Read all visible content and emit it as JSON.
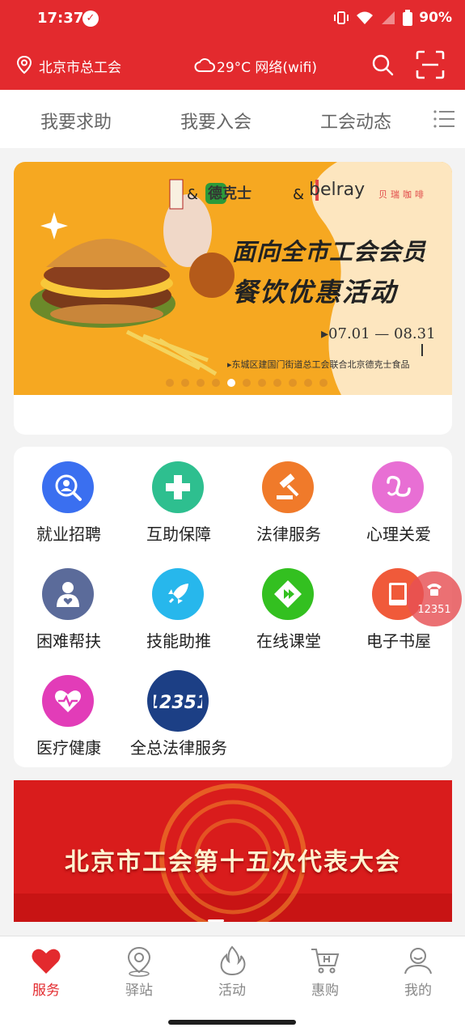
{
  "status": {
    "time": "17:37",
    "battery": "90%"
  },
  "header": {
    "location": "北京市总工会",
    "weather": "29°C  网络(wifi)"
  },
  "tabs": [
    {
      "label": "我要求助"
    },
    {
      "label": "我要入会"
    },
    {
      "label": "工会动态"
    }
  ],
  "banner": {
    "brand_de": "德克士",
    "brand_belray": "belray",
    "brand_coffee": "贝瑞咖啡",
    "amp": "&",
    "title_line1": "面向全市工会会员",
    "title_line2": "餐饮优惠活动",
    "date_range": "▸07.01 — 08.31",
    "subtitle": "▸东城区建国门街道总工会联合北京德克士食品",
    "dots_total": 11,
    "active_dot": 4
  },
  "services": [
    {
      "label": "就业招聘",
      "icon": "job-search-icon",
      "color": "#3a6ff0"
    },
    {
      "label": "互助保障",
      "icon": "medical-cross-icon",
      "color": "#2ebf8f"
    },
    {
      "label": "法律服务",
      "icon": "gavel-icon",
      "color": "#f07a2a"
    },
    {
      "label": "心理关爱",
      "icon": "heart-swirl-icon",
      "color": "#e86fd4"
    },
    {
      "label": "困难帮扶",
      "icon": "person-heart-icon",
      "color": "#5b6b9a"
    },
    {
      "label": "技能助推",
      "icon": "rocket-icon",
      "color": "#27b7ec"
    },
    {
      "label": "在线课堂",
      "icon": "play-video-icon",
      "color": "#33c020"
    },
    {
      "label": "电子书屋",
      "icon": "book-icon",
      "color": "#f05a3a"
    },
    {
      "label": "医疗健康",
      "icon": "heartbeat-icon",
      "color": "#e23cb8"
    },
    {
      "label": "全总法律服务",
      "icon": "12351-badge-icon",
      "color": "#1c3f85"
    }
  ],
  "float_call": {
    "number": "12351"
  },
  "bottom_banner": {
    "title": "北京市工会第十五次代表大会"
  },
  "nav": [
    {
      "label": "服务",
      "icon": "heart-icon",
      "active": true
    },
    {
      "label": "驿站",
      "icon": "map-pin-icon",
      "active": false
    },
    {
      "label": "活动",
      "icon": "flame-icon",
      "active": false
    },
    {
      "label": "惠购",
      "icon": "cart-icon",
      "active": false
    },
    {
      "label": "我的",
      "icon": "user-icon",
      "active": false
    }
  ],
  "colors": {
    "brand_red": "#e32a2e",
    "banner_orange": "#f6a821"
  }
}
